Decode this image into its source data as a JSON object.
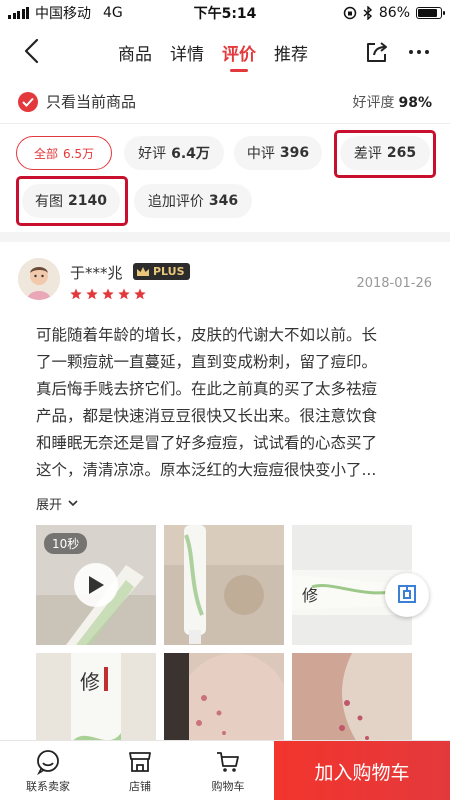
{
  "status_bar": {
    "carrier": "中国移动",
    "network": "4G",
    "time": "下午5:14",
    "battery": "86%",
    "battery_level": 0.86
  },
  "nav": {
    "tabs": [
      "商品",
      "详情",
      "评价",
      "推荐"
    ],
    "active_tab": "评价",
    "icons": [
      "back-arrow-icon",
      "share-icon",
      "more-icon"
    ]
  },
  "filter": {
    "only_current_label": "只看当前商品",
    "only_current_checked": true,
    "rating_label": "好评度",
    "rating_value": "98%"
  },
  "chips": [
    {
      "label": "全部",
      "count": "6.5万",
      "selected": true
    },
    {
      "label": "好评",
      "count": "6.4万",
      "selected": false
    },
    {
      "label": "中评",
      "count": "396",
      "selected": false
    },
    {
      "label": "差评",
      "count": "265",
      "selected": false
    },
    {
      "label": "有图",
      "count": "2140",
      "selected": false
    },
    {
      "label": "追加评价",
      "count": "346",
      "selected": false
    }
  ],
  "review": {
    "user": "于***兆",
    "badge": "PLUS",
    "stars": 5,
    "date": "2018-01-26",
    "text_lines": [
      "可能随着年龄的增长，皮肤的代谢大不如以前。长",
      "了一颗痘就一直蔓延，直到变成粉刺，留了痘印。",
      "真后悔手贱去挤它们。在此之前真的买了太多祛痘",
      "产品，都是快速消豆豆很快又长出来。很注意饮食",
      "和睡眠无奈还是冒了好多痘痘，试试看的心态买了",
      "这个，清清凉凉。原本泛红的大痘痘很快变小了..."
    ],
    "expand_label": "展开",
    "video_duration": "10秒"
  },
  "bottom_bar": {
    "contact_label": "联系卖家",
    "shop_label": "店铺",
    "cart_label": "购物车",
    "add_cart_label": "加入购物车"
  },
  "colors": {
    "accent": "#e4393c",
    "highlight": "#c8102e"
  }
}
